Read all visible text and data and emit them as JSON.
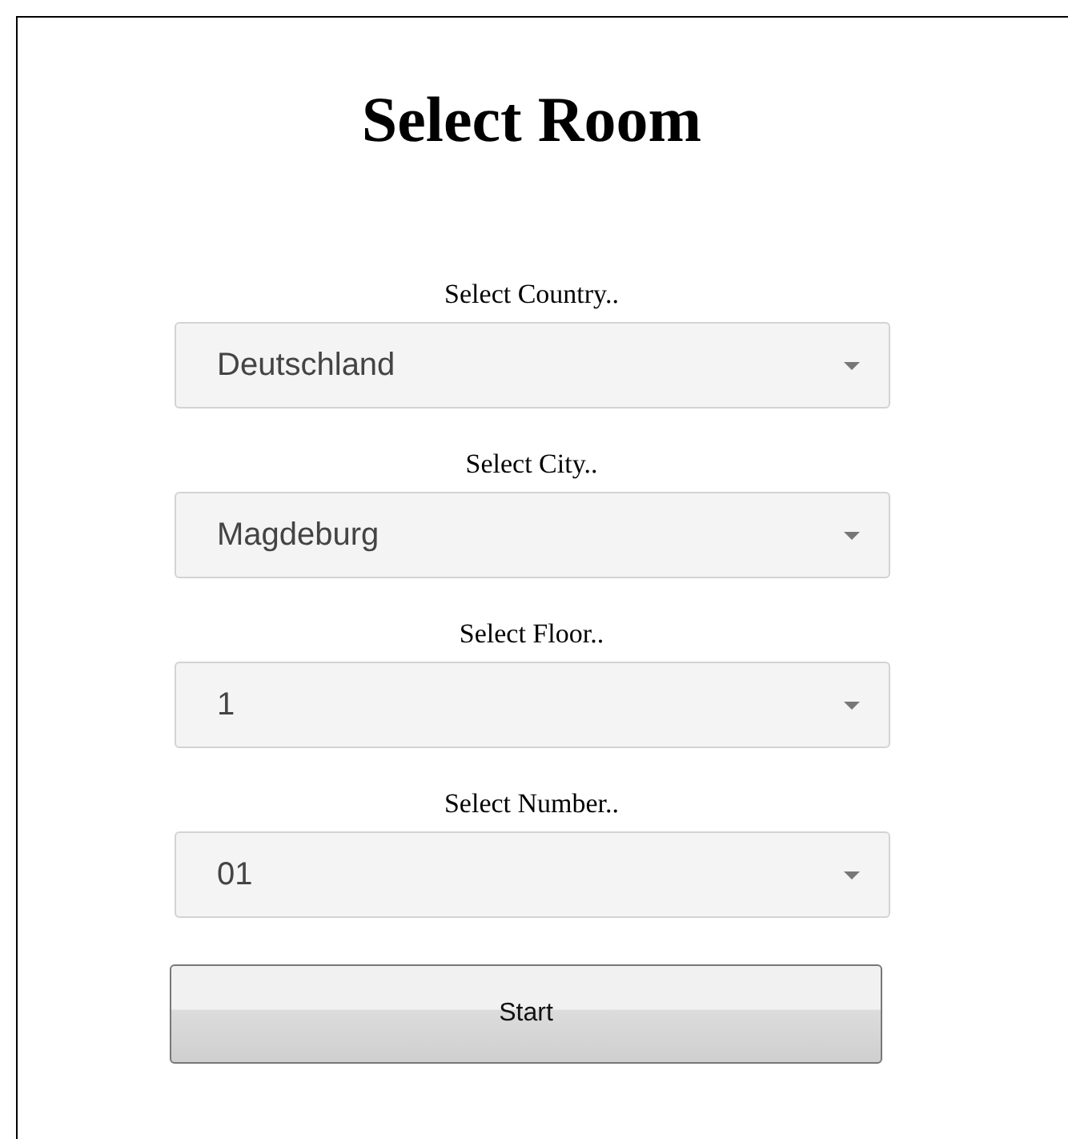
{
  "title": "Select Room",
  "selects": [
    {
      "label": "Select Country..",
      "value": "Deutschland"
    },
    {
      "label": "Select City..",
      "value": "Magdeburg"
    },
    {
      "label": "Select Floor..",
      "value": "1"
    },
    {
      "label": "Select Number..",
      "value": "01"
    }
  ],
  "button": "Start"
}
